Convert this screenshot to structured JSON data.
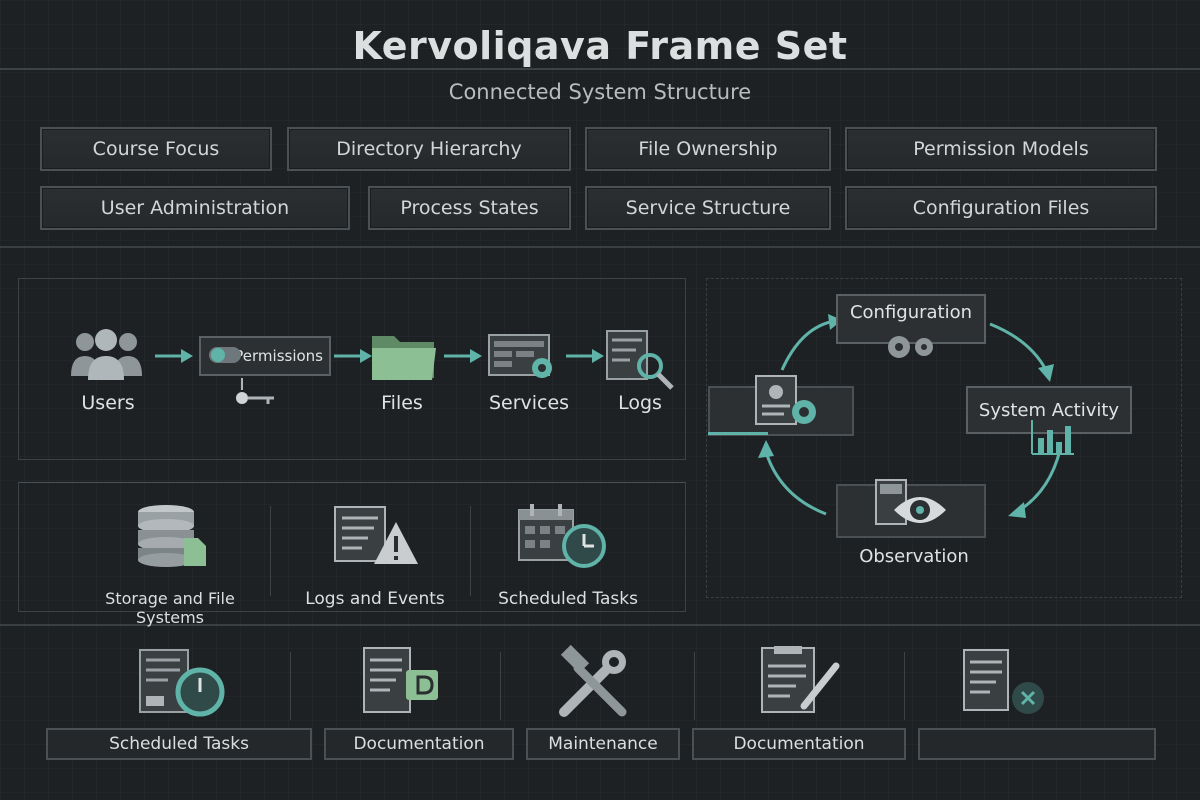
{
  "header": {
    "title": "Kervoliqava Frame Set",
    "subtitle": "Connected System Structure"
  },
  "topics": [
    "Course Focus",
    "Directory Hierarchy",
    "File Ownership",
    "Permission Models",
    "User Administration",
    "Process States",
    "Service Structure",
    "Configuration Files"
  ],
  "flow": {
    "users": "Users",
    "permissions": "Permissions",
    "files": "Files",
    "services": "Services",
    "logs": "Logs"
  },
  "cycle": {
    "configuration": "Configuration",
    "system_activity": "System Activity",
    "observation": "Observation"
  },
  "resources": {
    "storage": "Storage and File Systems",
    "logs_events": "Logs and Events",
    "scheduled": "Scheduled Tasks"
  },
  "tools": {
    "scheduled": "Scheduled Tasks",
    "documentation1": "Documentation",
    "maintenance": "Maintenance",
    "documentation2": "Documentation",
    "empty": ""
  },
  "colors": {
    "accent": "#5fb3a8",
    "folder": "#7fae87",
    "background": "#1e2123"
  }
}
